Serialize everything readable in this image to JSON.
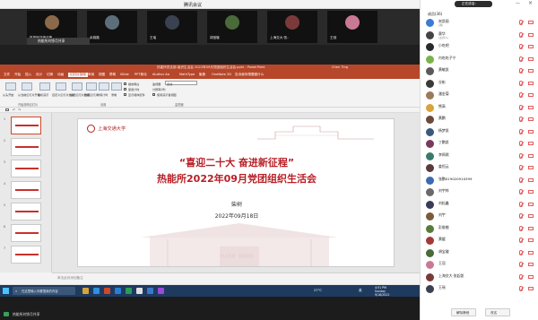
{
  "window": {
    "title": "腾讯会议"
  },
  "video_strip": {
    "tiles": [
      {
        "name": "热能所刘铮月等",
        "color": "#8a6a4a"
      },
      {
        "name": "余姚路",
        "color": "#5c6e7a"
      },
      {
        "name": "王瑶",
        "color": "#3a4150"
      },
      {
        "name": "胡宝璇",
        "color": "#4a6a3a"
      },
      {
        "name": "上海交大·张..",
        "color": "#7a3a3a"
      },
      {
        "name": "王冠",
        "color": "#c87a94"
      }
    ],
    "share_label": "热能所刘铮月共享"
  },
  "ppt": {
    "title": "热能所党支部-组织生活会 2022年09月党团组织生活会.pptx - PowerPoint",
    "user": "Chen Ting",
    "tabs": [
      "文件",
      "开始",
      "插入",
      "设计",
      "切换",
      "动画",
      "幻灯片放映",
      "审阅",
      "视图",
      "帮助",
      "iSlide",
      "PPT美化",
      "iAuthor Aa",
      "MathType",
      "聚焦",
      "OneNote 2D",
      "告诉我你想要做什么"
    ],
    "active_tab": "幻灯片放映",
    "ribbon": {
      "buttons": [
        "从头开始",
        "从当前幻灯片开始",
        "联机演示",
        "自定义幻灯片放映",
        "设置幻灯片放映",
        "隐藏幻灯片",
        "排练计时",
        "录制"
      ],
      "checks": [
        "播放旁白",
        "使用计时",
        "显示媒体控件"
      ],
      "monitor_label": "监视器",
      "monitor_value": "自动",
      "resolution_label": "分辨率(M):",
      "presenter_label": "使用演示者视图",
      "groups": [
        "开始放映幻灯片",
        "设置",
        "监视器"
      ]
    },
    "thumbnails": [
      "1",
      "2",
      "3",
      "4",
      "5",
      "6",
      "7",
      "8"
    ],
    "slide": {
      "university": "上海交通大学",
      "title1": "“喜迎二十大 奋进新征程”",
      "title2": "热能所2022年09月党团组织生活会",
      "author": "柴树",
      "date": "2022年09月18日",
      "watermark": "饮水思源 · 爱国荣校"
    },
    "notes_placeholder": "单击此处添加备注",
    "status_left": "幻灯片 第1张，共18张",
    "status_lang": "中文(中国)",
    "status_right": "备注  批注",
    "zoom": "71%"
  },
  "taskbar": {
    "search_placeholder": "在这里输入你要搜索的内容",
    "weather": "27°C",
    "time": "4:51 PM",
    "day": "Sunday",
    "date": "9/18/2022",
    "lang": "英"
  },
  "bottom_bar": {
    "label": "热能所刘铮月共享"
  },
  "panel": {
    "speaker": "正在讲话：",
    "members_title": "成员(36)",
    "members": [
      {
        "name": "宋凯丽",
        "sub": "(我)",
        "color": "#3a7bd5"
      },
      {
        "name": "赛华",
        "sub": "(主持人)",
        "color": "#444"
      },
      {
        "name": "小吃吧",
        "sub": "",
        "color": "#2a2a2a"
      },
      {
        "name": "内吃吃子宁",
        "sub": "",
        "color": "#7ab34a"
      },
      {
        "name": "黄敏凯",
        "sub": "",
        "color": "#5a5a5a"
      },
      {
        "name": "谷彬",
        "sub": "",
        "color": "#3a3a3a"
      },
      {
        "name": "潘金菊",
        "sub": "",
        "color": "#9a7a5a"
      },
      {
        "name": "熊高",
        "sub": "",
        "color": "#d9a23a"
      },
      {
        "name": "黄鹏",
        "sub": "",
        "color": "#6a4a3a"
      },
      {
        "name": "杨梦凯",
        "sub": "",
        "color": "#3a5a7a"
      },
      {
        "name": "丁鹏凯",
        "sub": "",
        "color": "#7a3a5a"
      },
      {
        "name": "李佩琪",
        "sub": "",
        "color": "#3a7a6a"
      },
      {
        "name": "姜恒云",
        "sub": "",
        "color": "#5a3a3a"
      },
      {
        "name": "张鹏019020910399",
        "sub": "",
        "color": "#3a6ab3"
      },
      {
        "name": "刘宇梓",
        "sub": "",
        "color": "#6a6a6a"
      },
      {
        "name": "刘松鑫",
        "sub": "",
        "color": "#3a3a5a"
      },
      {
        "name": "刘宇",
        "sub": "",
        "color": "#7a5a3a"
      },
      {
        "name": "彭俊楷",
        "sub": "",
        "color": "#5a7a3a"
      },
      {
        "name": "黄媛",
        "sub": "",
        "color": "#a33a3a"
      },
      {
        "name": "胡宝璇",
        "sub": "",
        "color": "#4a6a3a"
      },
      {
        "name": "王冠",
        "sub": "",
        "color": "#c87a94"
      },
      {
        "name": "上海交大·张起凯",
        "sub": "",
        "color": "#7a3a3a"
      },
      {
        "name": "王瑶",
        "sub": "",
        "color": "#3a4150"
      }
    ],
    "btn_mute_all": "解除静音",
    "btn_more": "改名"
  }
}
